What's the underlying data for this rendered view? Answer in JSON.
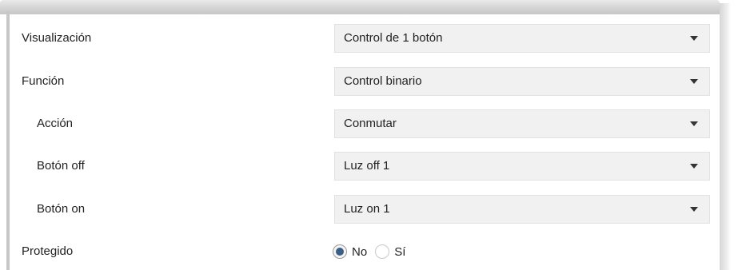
{
  "rows": [
    {
      "label": "Visualización",
      "value": "Control de 1 botón"
    },
    {
      "label": "Función",
      "value": "Control binario"
    },
    {
      "label": "Acción",
      "value": "Conmutar"
    },
    {
      "label": "Botón off",
      "value": "Luz off 1"
    },
    {
      "label": "Botón on",
      "value": "Luz on 1"
    }
  ],
  "protected": {
    "label": "Protegido",
    "options": [
      {
        "label": "No",
        "checked": true
      },
      {
        "label": "Sí",
        "checked": false
      }
    ]
  },
  "colors": {
    "radio_selected": "#3c5e86",
    "dropdown_bg": "#f1f1f1"
  },
  "icons": {
    "dropdown": "chevron-down-icon"
  }
}
